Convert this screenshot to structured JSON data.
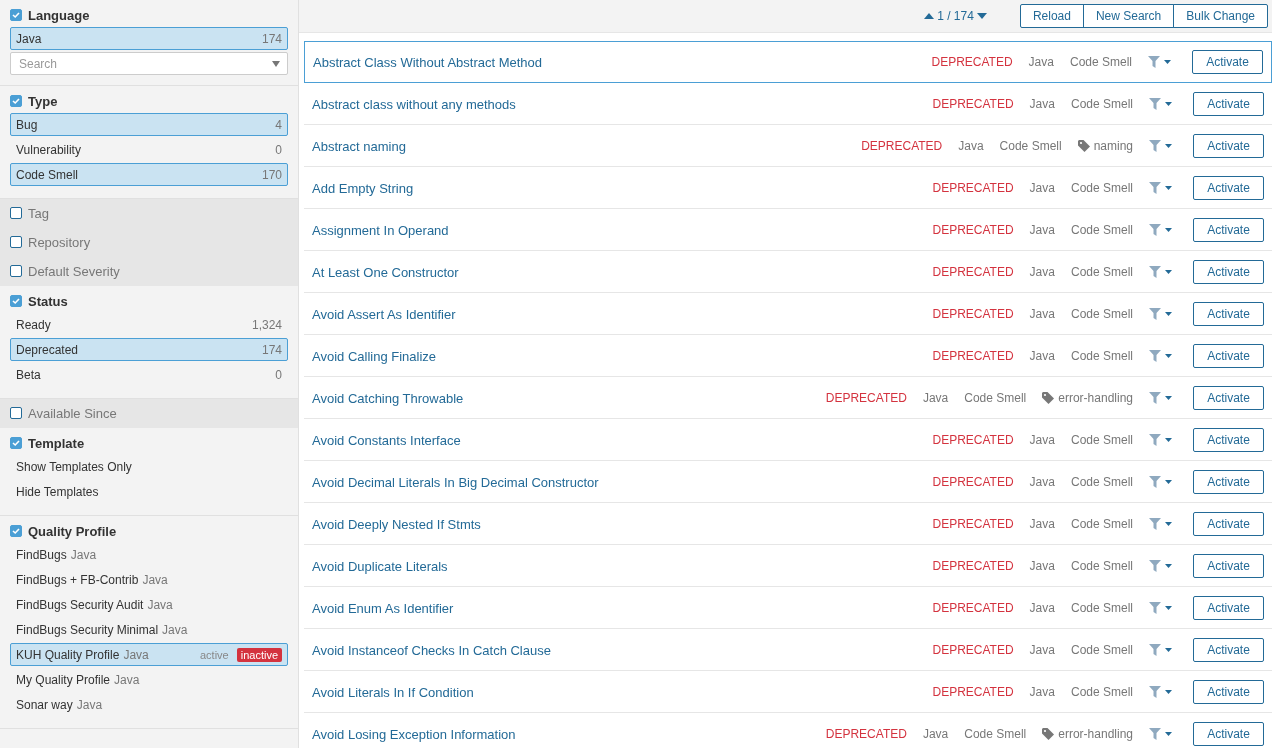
{
  "sidebar": {
    "facets": [
      {
        "title": "Language",
        "checked": true,
        "expanded": true,
        "items": [
          {
            "label": "Java",
            "count": "174",
            "selected": true
          }
        ],
        "search": {
          "placeholder": "Search"
        }
      },
      {
        "title": "Type",
        "checked": true,
        "expanded": true,
        "items": [
          {
            "label": "Bug",
            "count": "4",
            "selected": true
          },
          {
            "label": "Vulnerability",
            "count": "0",
            "selected": false
          },
          {
            "label": "Code Smell",
            "count": "170",
            "selected": true
          }
        ]
      },
      {
        "title": "Tag",
        "checked": false,
        "expanded": false
      },
      {
        "title": "Repository",
        "checked": false,
        "expanded": false
      },
      {
        "title": "Default Severity",
        "checked": false,
        "expanded": false
      },
      {
        "title": "Status",
        "checked": true,
        "expanded": true,
        "items": [
          {
            "label": "Ready",
            "count": "1,324",
            "selected": false
          },
          {
            "label": "Deprecated",
            "count": "174",
            "selected": true
          },
          {
            "label": "Beta",
            "count": "0",
            "selected": false
          }
        ]
      },
      {
        "title": "Available Since",
        "checked": false,
        "expanded": false
      },
      {
        "title": "Template",
        "checked": true,
        "expanded": true,
        "items": [
          {
            "label": "Show Templates Only",
            "selected": false
          },
          {
            "label": "Hide Templates",
            "selected": false
          }
        ]
      },
      {
        "title": "Quality Profile",
        "checked": true,
        "expanded": true,
        "items": [
          {
            "label": "FindBugs",
            "language": "Java",
            "selected": false
          },
          {
            "label": "FindBugs + FB-Contrib",
            "language": "Java",
            "selected": false
          },
          {
            "label": "FindBugs Security Audit",
            "language": "Java",
            "selected": false
          },
          {
            "label": "FindBugs Security Minimal",
            "language": "Java",
            "selected": false
          },
          {
            "label": "KUH Quality Profile",
            "language": "Java",
            "selected": true,
            "options": [
              {
                "label": "active",
                "selected": false
              },
              {
                "label": "inactive",
                "selected": true
              }
            ]
          },
          {
            "label": "My Quality Profile",
            "language": "Java",
            "selected": false
          },
          {
            "label": "Sonar way",
            "language": "Java",
            "selected": false
          }
        ]
      }
    ]
  },
  "toolbar": {
    "pager": "1 / 174",
    "buttons": [
      "Reload",
      "New Search",
      "Bulk Change"
    ]
  },
  "rules": [
    {
      "title": "Abstract Class Without Abstract Method",
      "status": "DEPRECATED",
      "language": "Java",
      "type": "Code Smell",
      "selected": true,
      "action": "Activate"
    },
    {
      "title": "Abstract class without any methods",
      "status": "DEPRECATED",
      "language": "Java",
      "type": "Code Smell",
      "selected": false,
      "action": "Activate"
    },
    {
      "title": "Abstract naming",
      "status": "DEPRECATED",
      "language": "Java",
      "type": "Code Smell",
      "tag": "naming",
      "selected": false,
      "action": "Activate"
    },
    {
      "title": "Add Empty String",
      "status": "DEPRECATED",
      "language": "Java",
      "type": "Code Smell",
      "selected": false,
      "action": "Activate"
    },
    {
      "title": "Assignment In Operand",
      "status": "DEPRECATED",
      "language": "Java",
      "type": "Code Smell",
      "selected": false,
      "action": "Activate"
    },
    {
      "title": "At Least One Constructor",
      "status": "DEPRECATED",
      "language": "Java",
      "type": "Code Smell",
      "selected": false,
      "action": "Activate"
    },
    {
      "title": "Avoid Assert As Identifier",
      "status": "DEPRECATED",
      "language": "Java",
      "type": "Code Smell",
      "selected": false,
      "action": "Activate"
    },
    {
      "title": "Avoid Calling Finalize",
      "status": "DEPRECATED",
      "language": "Java",
      "type": "Code Smell",
      "selected": false,
      "action": "Activate"
    },
    {
      "title": "Avoid Catching Throwable",
      "status": "DEPRECATED",
      "language": "Java",
      "type": "Code Smell",
      "tag": "error-handling",
      "selected": false,
      "action": "Activate"
    },
    {
      "title": "Avoid Constants Interface",
      "status": "DEPRECATED",
      "language": "Java",
      "type": "Code Smell",
      "selected": false,
      "action": "Activate"
    },
    {
      "title": "Avoid Decimal Literals In Big Decimal Constructor",
      "status": "DEPRECATED",
      "language": "Java",
      "type": "Code Smell",
      "selected": false,
      "action": "Activate"
    },
    {
      "title": "Avoid Deeply Nested If Stmts",
      "status": "DEPRECATED",
      "language": "Java",
      "type": "Code Smell",
      "selected": false,
      "action": "Activate"
    },
    {
      "title": "Avoid Duplicate Literals",
      "status": "DEPRECATED",
      "language": "Java",
      "type": "Code Smell",
      "selected": false,
      "action": "Activate"
    },
    {
      "title": "Avoid Enum As Identifier",
      "status": "DEPRECATED",
      "language": "Java",
      "type": "Code Smell",
      "selected": false,
      "action": "Activate"
    },
    {
      "title": "Avoid Instanceof Checks In Catch Clause",
      "status": "DEPRECATED",
      "language": "Java",
      "type": "Code Smell",
      "selected": false,
      "action": "Activate"
    },
    {
      "title": "Avoid Literals In If Condition",
      "status": "DEPRECATED",
      "language": "Java",
      "type": "Code Smell",
      "selected": false,
      "action": "Activate"
    },
    {
      "title": "Avoid Losing Exception Information",
      "status": "DEPRECATED",
      "language": "Java",
      "type": "Code Smell",
      "tag": "error-handling",
      "selected": false,
      "action": "Activate"
    }
  ]
}
